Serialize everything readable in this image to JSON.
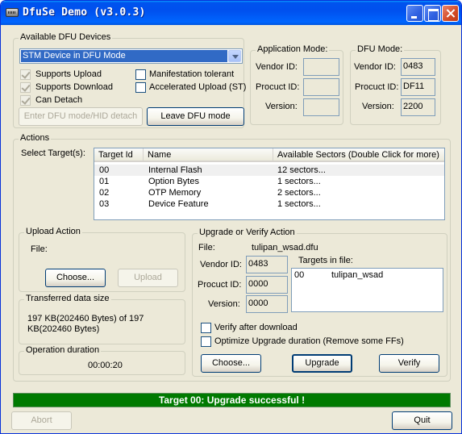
{
  "window": {
    "title": "DfuSe Demo (v3.0.3)",
    "icon": "usb-device-icon"
  },
  "devices": {
    "legend": "Available DFU Devices",
    "selected_device": "STM Device in DFU Mode",
    "checkboxes": [
      {
        "label": "Supports Upload",
        "checked": true
      },
      {
        "label": "Supports Download",
        "checked": true
      },
      {
        "label": "Can Detach",
        "checked": true
      },
      {
        "label": "Manifestation tolerant",
        "checked": false
      },
      {
        "label": "Accelerated Upload (ST)",
        "checked": false
      }
    ],
    "enter_dfu_label": "Enter DFU mode/HID detach",
    "leave_dfu_label": "Leave DFU mode"
  },
  "app_mode": {
    "legend": "Application Mode:",
    "vendor_label": "Vendor ID:",
    "product_label": "Procuct ID:",
    "version_label": "Version:",
    "vendor_value": "",
    "product_value": "",
    "version_value": ""
  },
  "dfu_mode": {
    "legend": "DFU Mode:",
    "vendor_label": "Vendor ID:",
    "product_label": "Procuct ID:",
    "version_label": "Version:",
    "vendor_value": "0483",
    "product_value": "DF11",
    "version_value": "2200"
  },
  "actions": {
    "legend": "Actions",
    "select_targets_label": "Select Target(s):",
    "columns": [
      "Target Id",
      "Name",
      "Available Sectors (Double Click for more)"
    ],
    "targets": [
      {
        "id": "00",
        "name": "Internal Flash",
        "sectors": "12 sectors..."
      },
      {
        "id": "01",
        "name": "Option Bytes",
        "sectors": "1 sectors..."
      },
      {
        "id": "02",
        "name": "OTP Memory",
        "sectors": "2 sectors..."
      },
      {
        "id": "03",
        "name": "Device Feature",
        "sectors": "1 sectors..."
      }
    ]
  },
  "upload": {
    "legend": "Upload Action",
    "file_label": "File:",
    "choose_label": "Choose...",
    "upload_label": "Upload"
  },
  "transferred": {
    "legend": "Transferred data size",
    "value": "197 KB(202460 Bytes) of 197 KB(202460 Bytes)"
  },
  "duration": {
    "legend": "Operation duration",
    "value": "00:00:20"
  },
  "upgrade": {
    "legend": "Upgrade or Verify Action",
    "file_label": "File:",
    "file_value": "tulipan_wsad.dfu",
    "vendor_label": "Vendor ID:",
    "vendor_value": "0483",
    "product_label": "Procuct ID:",
    "product_value": "0000",
    "version_label": "Version:",
    "version_value": "0000",
    "targets_label": "Targets in file:",
    "targets_in_file": [
      {
        "id": "00",
        "name": "tulipan_wsad"
      }
    ],
    "verify_after_label": "Verify after download",
    "verify_after_checked": false,
    "optimize_label": "Optimize Upgrade duration (Remove some FFs)",
    "optimize_checked": false,
    "choose_label": "Choose...",
    "upgrade_label": "Upgrade",
    "verify_label": "Verify"
  },
  "status": {
    "message": "Target 00: Upgrade successful !",
    "progress_fraction": 1.0,
    "color": "#007a00"
  },
  "footer": {
    "abort_label": "Abort",
    "quit_label": "Quit"
  }
}
